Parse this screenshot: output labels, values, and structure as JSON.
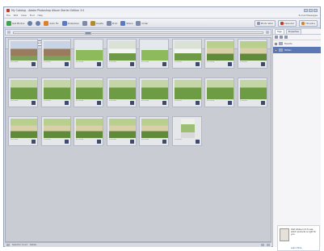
{
  "window": {
    "title": "My Catalog - Adobe Photoshop Album Starter Edition 3.0"
  },
  "menubar": {
    "items": [
      "File",
      "Edit",
      "View",
      "Find",
      "Help"
    ],
    "right_link": "E-mail Messages"
  },
  "toolbar": {
    "items": [
      {
        "label": "Get Photos",
        "icon": "camera-icon",
        "color": "#3fa34d"
      },
      {
        "label": "Back",
        "icon": "back-arrow-icon",
        "color": "#6a7ea8"
      },
      {
        "label": "Forward",
        "icon": "forward-arrow-icon",
        "color": "#6a7ea8"
      },
      {
        "label": "Auto Fix",
        "icon": "wand-icon",
        "color": "#d9822b"
      },
      {
        "label": "Slideshow",
        "icon": "slideshow-icon",
        "color": "#5b79c0"
      },
      {
        "label": "Rotate",
        "icon": "rotate-icon",
        "color": "#7d8aa8"
      },
      {
        "label": "Create",
        "icon": "create-icon",
        "color": "#b48a2e"
      },
      {
        "label": "Print",
        "icon": "printer-icon",
        "color": "#7d8aa8"
      },
      {
        "label": "Share",
        "icon": "share-icon",
        "color": "#5b79c0"
      },
      {
        "label": "Order",
        "icon": "order-icon",
        "color": "#7d8aa8"
      }
    ],
    "right_buttons": [
      {
        "label": "Photo Well",
        "icon": "photo-well-icon"
      },
      {
        "label": "Calendar",
        "icon": "calendar-icon"
      },
      {
        "label": "Timeline",
        "icon": "timeline-icon"
      }
    ]
  },
  "gallery": {
    "label": "Gallery",
    "chip": "Show All"
  },
  "thumbnails": [
    {
      "kind": "building",
      "meta": "6/1/2004"
    },
    {
      "kind": "building",
      "meta": "6/1/2004"
    },
    {
      "kind": "field",
      "meta": "6/1/2004"
    },
    {
      "kind": "car",
      "meta": "6/1/2004"
    },
    {
      "kind": "field",
      "meta": "6/1/2004"
    },
    {
      "kind": "car",
      "meta": "6/1/2004"
    },
    {
      "kind": "crowd",
      "meta": "6/1/2004"
    },
    {
      "kind": "crowd",
      "meta": "6/1/2004"
    },
    {
      "kind": "field_people",
      "meta": "6/1/2004"
    },
    {
      "kind": "field_people",
      "meta": "6/1/2004"
    },
    {
      "kind": "field_people",
      "meta": "6/1/2004"
    },
    {
      "kind": "field_people",
      "meta": "6/1/2004"
    },
    {
      "kind": "field_people",
      "meta": "6/1/2004"
    },
    {
      "kind": "field_people",
      "meta": "6/1/2004"
    },
    {
      "kind": "field_people",
      "meta": "6/1/2004"
    },
    {
      "kind": "field_people",
      "meta": "6/1/2004"
    },
    {
      "kind": "crowd",
      "meta": "6/1/2004"
    },
    {
      "kind": "crowd",
      "meta": "6/1/2004"
    },
    {
      "kind": "crowd",
      "meta": "6/1/2004"
    },
    {
      "kind": "crowd",
      "meta": "6/1/2004"
    },
    {
      "kind": "crowd",
      "meta": "6/1/2004"
    },
    {
      "kind": "portrait",
      "meta": "6/1/2004"
    }
  ],
  "statusbar": {
    "left_label": "Selection Count",
    "mid_label": "Details"
  },
  "rightpanel": {
    "tabs": [
      "Tags",
      "Properties"
    ],
    "rows": [
      {
        "label": "Favorite",
        "selected": false
      },
      {
        "label": "Hidden",
        "selected": true
      }
    ]
  },
  "ad": {
    "text": "Visit Adobe.com to see which products is right for you.",
    "link": "Learn More"
  }
}
